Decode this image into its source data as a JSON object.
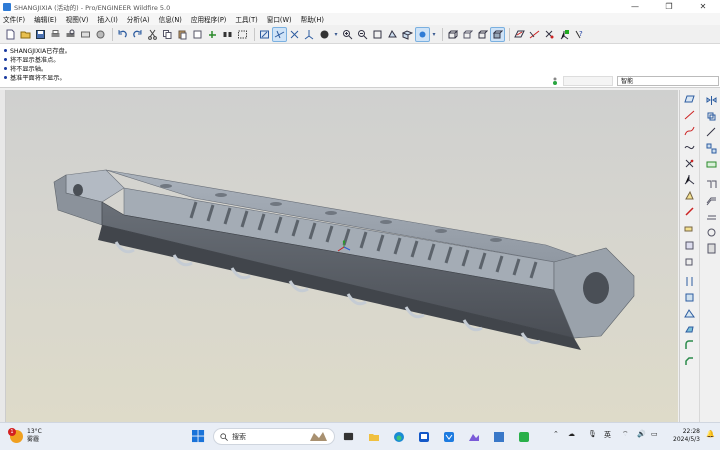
{
  "window": {
    "title": "SHANGJIXIA (活动的) - Pro/ENGINEER Wildfire 5.0",
    "minimize": "—",
    "maximize": "❐",
    "close": "✕"
  },
  "menu": [
    "文件(F)",
    "编辑(E)",
    "视图(V)",
    "插入(I)",
    "分析(A)",
    "信息(N)",
    "应用程序(P)",
    "工具(T)",
    "窗口(W)",
    "帮助(H)"
  ],
  "messages": [
    "SHANGJIXIA已存盘。",
    "将不显示基准点。",
    "将不显示轴。",
    "基准平面将不显示。"
  ],
  "filter": {
    "value": "智能"
  },
  "taskbar": {
    "weather_temp": "13°C",
    "weather_desc": "雾霾",
    "badge": "1",
    "search_placeholder": "搜索",
    "ime": "英",
    "time": "22:28",
    "date": "2024/5/3"
  },
  "colors": {
    "accent": "#2e7bd6",
    "model_top": "#9aa3ad",
    "model_side": "#5b6067",
    "viewport_top": "#cfd0cf",
    "viewport_bottom": "#dedbc9"
  }
}
